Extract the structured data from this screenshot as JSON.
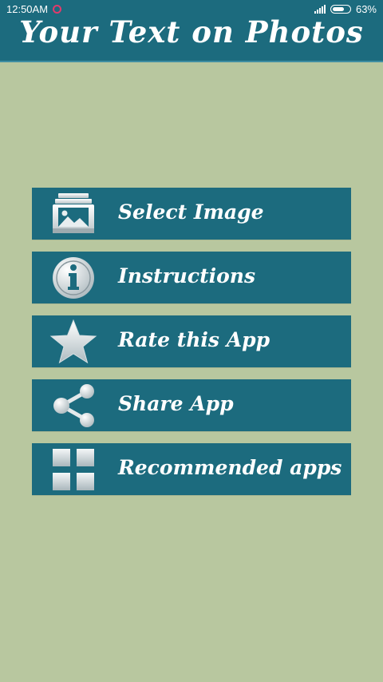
{
  "status_bar": {
    "time": "12:50AM",
    "battery": "63%"
  },
  "header": {
    "title": "Your Text on Photos"
  },
  "menu": {
    "items": [
      {
        "label": "Select Image",
        "icon": "gallery-icon"
      },
      {
        "label": "Instructions",
        "icon": "info-icon"
      },
      {
        "label": "Rate this App",
        "icon": "star-icon"
      },
      {
        "label": "Share App",
        "icon": "share-icon"
      },
      {
        "label": "Recommended apps",
        "icon": "grid-icon"
      }
    ]
  },
  "colors": {
    "background": "#b8c79f",
    "primary": "#1c6b7e",
    "text": "#ffffff"
  }
}
